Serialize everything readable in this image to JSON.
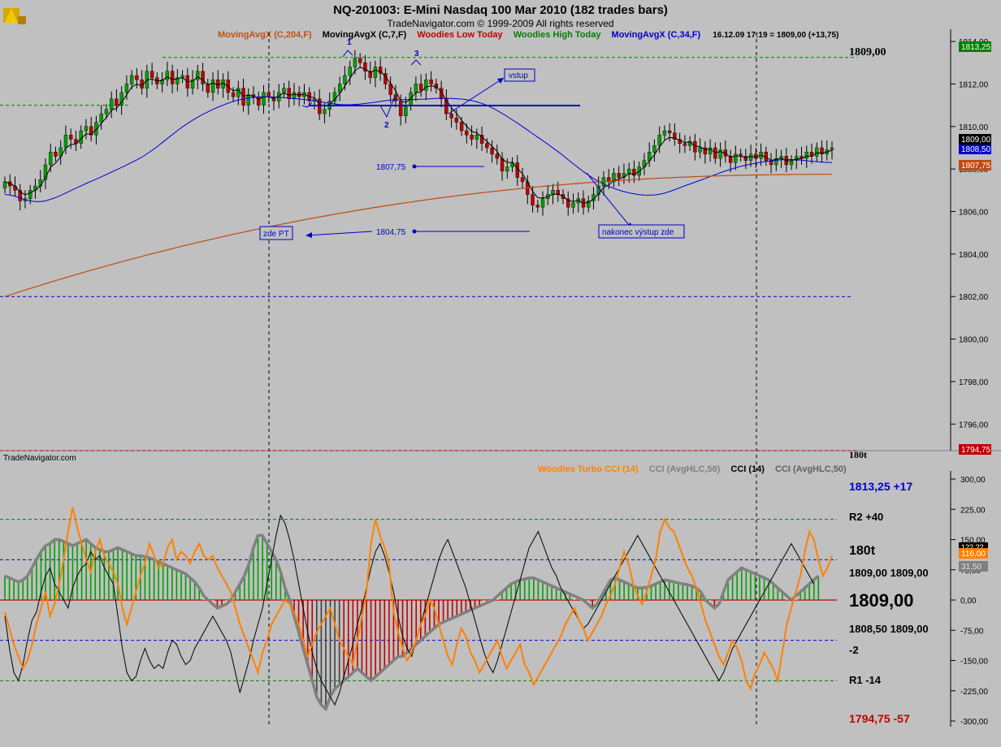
{
  "header": {
    "title": "NQ-201003:  E-Mini Nasdaq 100 Mar 2010  (182 trades bars)",
    "subtitle": "TradeNavigator.com © 1999-2009 All rights reserved",
    "indicators": [
      {
        "label": "MovingAvgX (C,204,F)",
        "color": "#c05010"
      },
      {
        "label": "MovingAvgX (C,7,F)",
        "color": "#000000"
      },
      {
        "label": "Woodies Low Today",
        "color": "#c00000"
      },
      {
        "label": "Woodies High Today",
        "color": "#008000"
      },
      {
        "label": "MovingAvgX (C,34,F)",
        "color": "#0000cc"
      }
    ],
    "info": "16.12.09 17:19 = 1809,00 (+13,75)"
  },
  "colors": {
    "background": "#c0c0c0",
    "bull": "#00a000",
    "bear": "#c00000",
    "ma7": "#000000",
    "ma34": "#0000dd",
    "ma204": "#c04a10",
    "cci_turbo": "#ff8000",
    "cci_avg": "#808080",
    "cci14": "#000000",
    "annotation": "#0000cc"
  },
  "price_panel": {
    "label_1809": "1809,00",
    "label_180t": "180t",
    "tick_labels": [
      "1814,00",
      "1812,00",
      "1810,00",
      "1808,00",
      "1806,00",
      "1804,00",
      "1802,00",
      "1800,00",
      "1798,00",
      "1796,00"
    ],
    "badges": {
      "top": "1813,25",
      "current": "1809,00",
      "ma34": "1808,50",
      "ma204": "1807,75",
      "bottom": "1794,75"
    },
    "annotations": {
      "vstup": "vstup",
      "zde_pt": "zde PT",
      "exit": "nakonec výstup zde",
      "level_1807": "1807,75",
      "level_1804": "1804,75",
      "wave1": "1",
      "wave2": "2",
      "wave3": "3"
    }
  },
  "cci_panel": {
    "source": "TradeNavigator.com",
    "legend": [
      {
        "label": "Woodies Turbo CCI (14)",
        "color": "#ff8000"
      },
      {
        "label": "CCI (AvgHLC,50)",
        "color": "#808080"
      },
      {
        "label": "CCI (14)",
        "color": "#000000"
      },
      {
        "label": "CCI (AvgHLC,50)",
        "color": "#606060"
      }
    ],
    "tick_labels": [
      "300,00",
      "225,00",
      "150,00",
      "75,00",
      "0,00",
      "-75,00",
      "-150,00",
      "-225,00",
      "-300,00"
    ],
    "badges": {
      "cci14": "1??,??",
      "turbo": "116,00",
      "avg": "31,50"
    },
    "side": {
      "r3": "1813,25 +17",
      "r2": "R2 +40",
      "t": "180t",
      "a1": "1809,00  1809,00",
      "main": "1809,00",
      "b1": "1808,50  1809,00",
      "m2": "-2",
      "r1": "R1 -14",
      "low": "1794,75 -57"
    }
  },
  "chart_data": [
    {
      "type": "candlestick",
      "title": "NQ-201003:  E-Mini Nasdaq 100 Mar 2010  (182 trades bars)",
      "ylim": [
        1794.75,
        1814.5
      ],
      "grid": false,
      "levels": {
        "woodies_high": 1813.25,
        "woodies_low": 1802.0,
        "entry_line": 1810.5
      },
      "close": [
        1807.4,
        1807.2,
        1807.0,
        1806.5,
        1806.6,
        1807.0,
        1807.2,
        1807.5,
        1808.2,
        1808.8,
        1808.6,
        1809.0,
        1809.6,
        1809.4,
        1809.2,
        1809.8,
        1810.0,
        1809.6,
        1810.2,
        1810.6,
        1810.8,
        1811.3,
        1811.0,
        1811.6,
        1812.0,
        1812.4,
        1812.2,
        1811.8,
        1812.6,
        1812.3,
        1812.0,
        1812.2,
        1812.6,
        1812.0,
        1812.3,
        1812.4,
        1811.8,
        1812.2,
        1812.6,
        1812.0,
        1811.6,
        1812.2,
        1811.8,
        1812.2,
        1811.6,
        1811.4,
        1811.8,
        1811.0,
        1811.5,
        1811.4,
        1811.0,
        1811.6,
        1811.4,
        1811.2,
        1811.6,
        1811.8,
        1811.3,
        1811.6,
        1811.4,
        1811.6,
        1811.2,
        1811.3,
        1810.6,
        1810.8,
        1811.2,
        1811.6,
        1812.0,
        1812.4,
        1812.8,
        1813.2,
        1813.0,
        1812.6,
        1812.3,
        1812.8,
        1812.5,
        1812.0,
        1811.5,
        1811.2,
        1810.5,
        1811.0,
        1811.6,
        1812.0,
        1811.7,
        1812.2,
        1812.0,
        1811.8,
        1811.3,
        1810.6,
        1810.4,
        1810.2,
        1809.8,
        1809.6,
        1809.4,
        1809.6,
        1809.2,
        1809.0,
        1808.7,
        1808.5,
        1807.9,
        1808.1,
        1808.3,
        1807.6,
        1807.4,
        1806.8,
        1806.3,
        1806.2,
        1806.6,
        1806.8,
        1807.0,
        1806.8,
        1806.6,
        1806.2,
        1806.4,
        1806.6,
        1806.2,
        1806.5,
        1806.8,
        1807.2,
        1807.6,
        1807.4,
        1807.8,
        1807.6,
        1807.8,
        1808.0,
        1807.7,
        1808.1,
        1808.4,
        1808.8,
        1809.1,
        1809.6,
        1809.8,
        1809.7,
        1809.4,
        1809.2,
        1809.1,
        1809.3,
        1808.8,
        1809.0,
        1808.7,
        1809.0,
        1808.5,
        1808.9,
        1808.6,
        1808.3,
        1808.7,
        1808.6,
        1808.4,
        1808.7,
        1808.5,
        1808.8,
        1808.4,
        1808.2,
        1808.5,
        1808.6,
        1808.2,
        1808.4,
        1808.6,
        1808.5,
        1808.8,
        1808.6,
        1809.0,
        1808.7,
        1808.9,
        1809.0
      ]
    },
    {
      "type": "line",
      "title": "Woodies Turbo CCI (14) / CCI (AvgHLC,50) / CCI (14)",
      "ylim": [
        -300,
        300
      ],
      "x_count": 182,
      "levels": [
        200,
        100,
        0,
        -100,
        -200
      ],
      "series": [
        {
          "name": "Woodies Turbo CCI (14)",
          "values": [
            -30,
            -70,
            -110,
            -140,
            -170,
            -150,
            -110,
            -60,
            -20,
            20,
            -40,
            -10,
            40,
            100,
            170,
            230,
            180,
            140,
            100,
            70,
            120,
            150,
            110,
            90,
            70,
            40,
            -20,
            -60,
            -20,
            20,
            60,
            90,
            140,
            110,
            80,
            90,
            130,
            150,
            100,
            120,
            110,
            90,
            120,
            140,
            110,
            100,
            110,
            80,
            60,
            40,
            20,
            -20,
            -60,
            -90,
            -120,
            -150,
            -180,
            -130,
            -100,
            -60,
            -40,
            -20,
            0,
            -10,
            -30,
            -60,
            -100,
            -140,
            -110,
            -80,
            -60,
            -40,
            -20,
            -60,
            -100,
            -120,
            -140,
            -160,
            -100,
            -40,
            20,
            140,
            200,
            160,
            130,
            90,
            -30,
            -80,
            -120,
            -150,
            -130,
            -100,
            -60,
            -40,
            0,
            -20,
            -60,
            -100,
            -140,
            -160,
            -110,
            -70,
            -90,
            -130,
            -150,
            -180,
            -160,
            -140,
            -120,
            -100,
            -140,
            -170,
            -150,
            -130,
            -110,
            -160,
            -180,
            -210,
            -190,
            -170,
            -150,
            -130,
            -110,
            -90,
            -60,
            -40,
            -20,
            -50,
            -70,
            -100,
            -80,
            -60,
            -40,
            -10,
            10,
            40,
            80,
            120,
            90,
            40,
            10,
            -10,
            20,
            60,
            100,
            170,
            200,
            180,
            170,
            140,
            110,
            80,
            60,
            30,
            -10,
            -50,
            -80,
            -110,
            -140,
            -160,
            -130,
            -100,
            -120,
            -150,
            -200,
            -220,
            -180,
            -160,
            -130,
            -150,
            -170,
            -200,
            -130,
            -60,
            -20,
            20,
            60,
            120,
            170,
            150,
            100,
            60,
            80,
            110
          ]
        },
        {
          "name": "CCI (AvgHLC,50)",
          "values": [
            60,
            55,
            50,
            45,
            50,
            60,
            80,
            100,
            120,
            135,
            140,
            150,
            150,
            145,
            140,
            135,
            140,
            145,
            150,
            140,
            130,
            125,
            120,
            120,
            125,
            130,
            125,
            120,
            115,
            110,
            110,
            108,
            105,
            100,
            95,
            90,
            85,
            80,
            75,
            70,
            65,
            55,
            45,
            30,
            10,
            0,
            -10,
            -20,
            -15,
            -10,
            0,
            20,
            40,
            60,
            90,
            130,
            160,
            160,
            140,
            120,
            100,
            70,
            30,
            0,
            -40,
            -80,
            -120,
            -160,
            -200,
            -240,
            -260,
            -270,
            -240,
            -220,
            -210,
            -200,
            -190,
            -180,
            -170,
            -180,
            -190,
            -200,
            -190,
            -180,
            -170,
            -160,
            -150,
            -140,
            -140,
            -130,
            -120,
            -110,
            -100,
            -90,
            -80,
            -70,
            -60,
            -55,
            -50,
            -45,
            -40,
            -35,
            -30,
            -25,
            -20,
            -15,
            -10,
            -5,
            0,
            10,
            20,
            30,
            40,
            45,
            50,
            52,
            55,
            55,
            50,
            45,
            40,
            35,
            30,
            25,
            20,
            15,
            10,
            5,
            0,
            -10,
            -20,
            -10,
            10,
            30,
            50,
            55,
            50,
            45,
            40,
            35,
            30,
            30,
            32,
            35,
            40,
            45,
            50,
            48,
            45,
            42,
            40,
            38,
            35,
            30,
            20,
            0,
            -10,
            -20,
            -10,
            20,
            50,
            60,
            70,
            80,
            75,
            70,
            65,
            60,
            55,
            50,
            40,
            30,
            20,
            10,
            0,
            10,
            20,
            30,
            40,
            50,
            60
          ]
        },
        {
          "name": "CCI (14)",
          "values": [
            -40,
            -120,
            -180,
            -200,
            -160,
            -100,
            -50,
            -30,
            20,
            60,
            80,
            40,
            20,
            0,
            -20,
            30,
            60,
            80,
            90,
            120,
            100,
            110,
            80,
            60,
            40,
            -40,
            -120,
            -180,
            -200,
            -190,
            -150,
            -120,
            -150,
            -170,
            -160,
            -170,
            -130,
            -100,
            -110,
            -140,
            -160,
            -150,
            -120,
            -100,
            -80,
            -60,
            -40,
            -60,
            -80,
            -100,
            -130,
            -180,
            -230,
            -190,
            -150,
            -100,
            -60,
            -20,
            40,
            100,
            160,
            210,
            190,
            150,
            100,
            40,
            -20,
            -80,
            -130,
            -170,
            -200,
            -220,
            -240,
            -260,
            -230,
            -190,
            -150,
            -110,
            -60,
            -20,
            30,
            80,
            120,
            140,
            110,
            70,
            20,
            -40,
            -90,
            -120,
            -140,
            -100,
            -60,
            -20,
            20,
            60,
            100,
            130,
            150,
            120,
            90,
            60,
            30,
            -10,
            -50,
            -90,
            -130,
            -160,
            -180,
            -150,
            -110,
            -70,
            -30,
            10,
            50,
            90,
            130,
            150,
            170,
            140,
            110,
            80,
            60,
            30,
            10,
            -10,
            -30,
            -50,
            -70,
            -60,
            -40,
            -20,
            0,
            20,
            40,
            60,
            80,
            100,
            120,
            140,
            160,
            140,
            120,
            100,
            80,
            60,
            40,
            20,
            0,
            -20,
            -40,
            -60,
            -80,
            -100,
            -120,
            -140,
            -160,
            -180,
            -200,
            -180,
            -150,
            -120,
            -100,
            -80,
            -60,
            -40,
            -20,
            0,
            20,
            40,
            60,
            80,
            100,
            120,
            140,
            120,
            100,
            80,
            60,
            40
          ]
        }
      ]
    }
  ]
}
